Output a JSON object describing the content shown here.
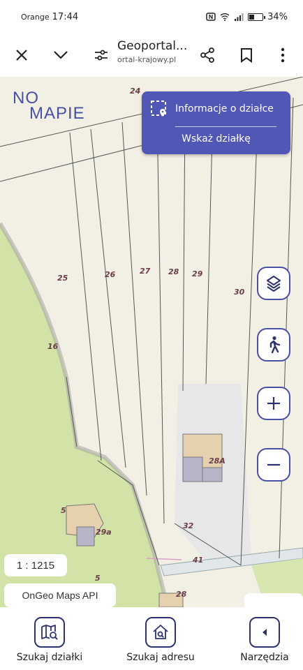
{
  "status_bar": {
    "carrier": "Orange",
    "time": "17:44",
    "battery": "34%",
    "battery_level": 0.34
  },
  "browser": {
    "title": "Geoportal...",
    "url": "ortal-krajowy.pl"
  },
  "map": {
    "logo": {
      "line1": "NO",
      "line2": "MAPIE"
    },
    "info_panel": {
      "info_label": "Informacje o działce",
      "point_label": "Wskaż działkę"
    },
    "scale": "1 : 1215",
    "attribution": "OnGeo Maps API",
    "plot_labels": [
      "24",
      "25",
      "26",
      "27",
      "28",
      "29",
      "30",
      "16",
      "28A",
      "5",
      "29a",
      "32",
      "41",
      "5",
      "28"
    ]
  },
  "bottom_nav": {
    "items": [
      {
        "label": "Szukaj działki",
        "icon": "map-search-icon"
      },
      {
        "label": "Szukaj adresu",
        "icon": "home-search-icon"
      },
      {
        "label": "Narzędzia",
        "icon": "chevron-left-icon"
      }
    ]
  },
  "colors": {
    "accent": "#5157b5",
    "accent_dark": "#2e3170",
    "map_bg": "#f2f0e4",
    "green": "#cfe0a2"
  }
}
